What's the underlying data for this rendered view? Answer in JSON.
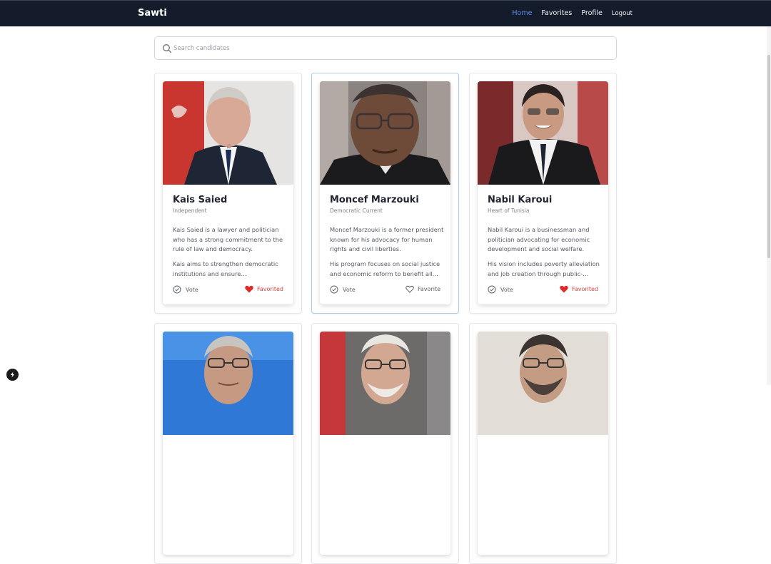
{
  "app": {
    "title": "Sawti"
  },
  "nav": {
    "home": "Home",
    "favorites": "Favorites",
    "profile": "Profile",
    "logout": "Logout"
  },
  "search": {
    "placeholder": "Search candidates",
    "value": ""
  },
  "candidates": [
    {
      "name": "Kais Saied",
      "party": "Independent",
      "description": "Kais Saied is a lawyer and politician who has a strong commitment to the rule of law and democracy.",
      "goal": "Kais aims to strengthen democratic institutions and ensure transparency…",
      "vote_label": "Vote",
      "favorite_label": "Favorited",
      "favorited": true
    },
    {
      "name": "Moncef Marzouki",
      "party": "Democratic Current",
      "description": "Moncef Marzouki is a former president known for his advocacy for human rights and civil liberties.",
      "goal": "His program focuses on social justice and economic reform to benefit all…",
      "vote_label": "Vote",
      "favorite_label": "Favorite",
      "favorited": false
    },
    {
      "name": "Nabil Karoui",
      "party": "Heart of Tunisia",
      "description": "Nabil Karoui is a businessman and politician advocating for economic development and social welfare.",
      "goal": "His vision includes poverty alleviation and job creation through public-…",
      "vote_label": "Vote",
      "favorite_label": "Favorited",
      "favorited": true
    }
  ],
  "colors": {
    "navbar": "#141b2b",
    "active_link": "#5b8fe6",
    "favorited": "#d64040"
  }
}
